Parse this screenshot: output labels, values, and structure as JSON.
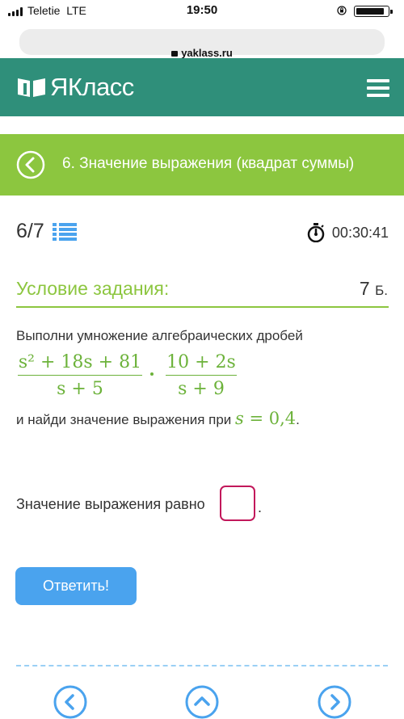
{
  "status_bar": {
    "carrier": "Teletie",
    "network": "LTE",
    "time": "19:50"
  },
  "browser": {
    "url": "yaklass.ru"
  },
  "header": {
    "logo_text": "ЯКласс",
    "brand_color": "#2f8f7a"
  },
  "topic": {
    "title": "6. Значение выражения (квадрат суммы)",
    "bar_color": "#8cc63f"
  },
  "progress": {
    "counter": "6/7",
    "timer": "00:30:41"
  },
  "condition": {
    "title": "Условие задания:",
    "points": "7",
    "points_unit": "Б."
  },
  "task": {
    "intro": "Выполни умножение алгебраических дробей",
    "fraction1_num": "s² + 18s + 81",
    "fraction1_den": "s + 5",
    "fraction2_num": "10 + 2s",
    "fraction2_den": "s + 9",
    "find_text": "и найди значение выражения при ",
    "var_name": "s",
    "equals": " = ",
    "value": "0,4",
    "end": "."
  },
  "answer": {
    "label": "Значение выражения равно",
    "input_value": "",
    "end": "."
  },
  "submit_label": "Ответить!",
  "icons": {
    "back": "chevron-left-circle-icon",
    "list": "list-icon",
    "timer": "stopwatch-icon",
    "prev": "chevron-left-icon",
    "up": "chevron-up-icon",
    "next": "chevron-right-icon"
  }
}
